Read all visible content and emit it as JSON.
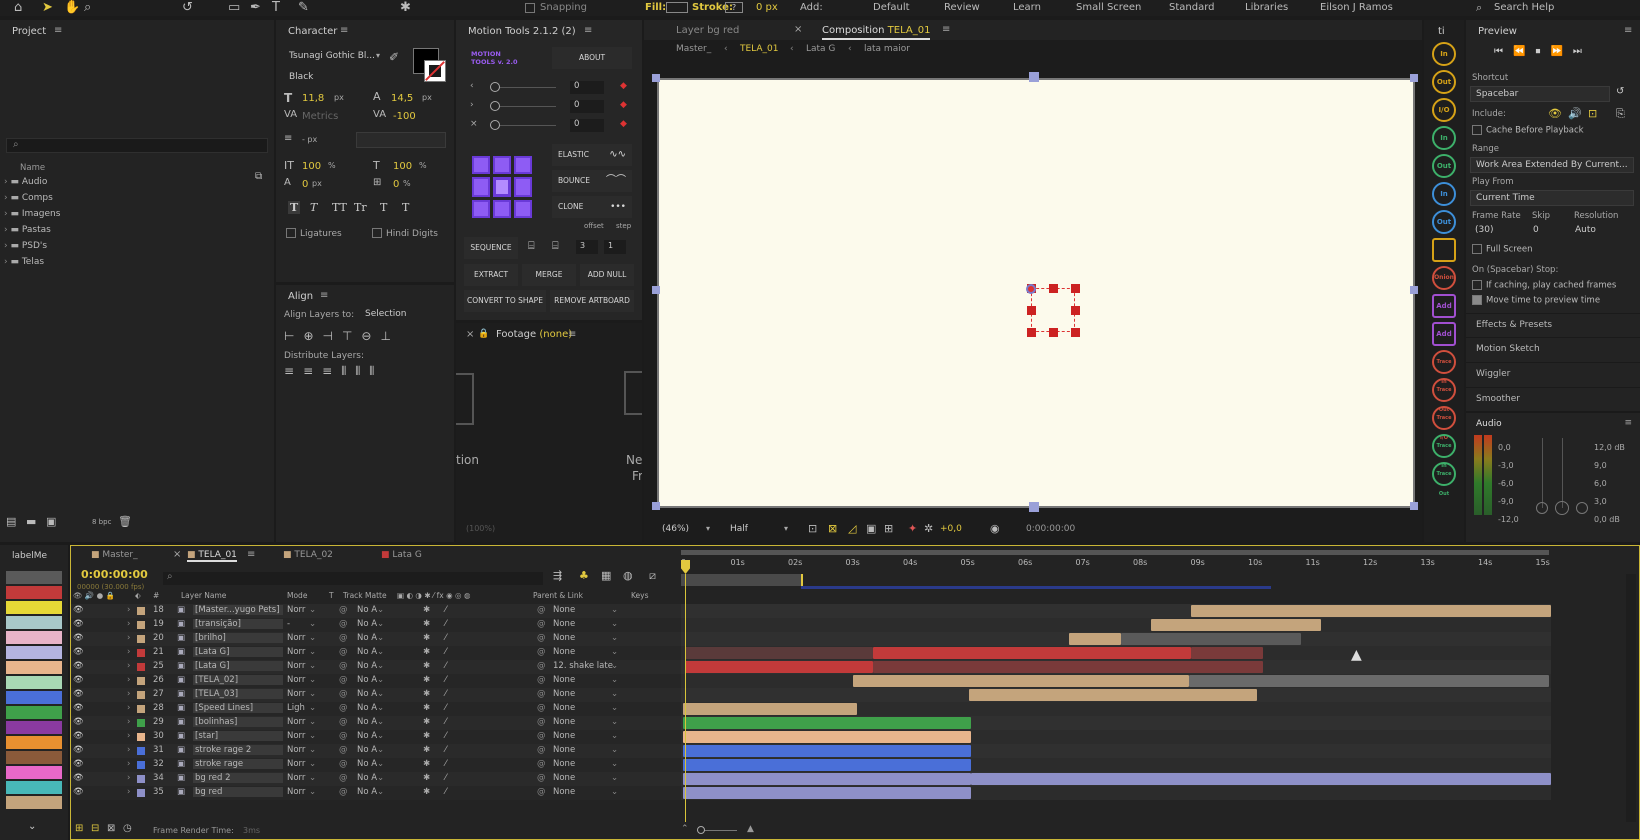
{
  "toolbar": {
    "fill_label": "Fill:",
    "stroke_label": "Stroke:",
    "stroke_value": "0 px",
    "add_label": "Add:",
    "snapping": "Snapping",
    "workspaces": [
      "Default",
      "Review",
      "Learn",
      "Small Screen",
      "Standard",
      "Libraries",
      "Eilson J Ramos"
    ],
    "search_help": "Search Help"
  },
  "project": {
    "title": "Project",
    "search_placeholder": "",
    "name_header": "Name",
    "folders": [
      "Audio",
      "Comps",
      "Imagens",
      "Pastas",
      "PSD's",
      "Telas"
    ],
    "bpc": "8 bpc"
  },
  "character": {
    "title": "Character",
    "font": "Tsunagi Gothic Bl...",
    "style": "Black",
    "size": "11,8",
    "size_unit": "px",
    "leading": "14,5",
    "leading_unit": "px",
    "kerning": "Metrics",
    "tracking": "-100",
    "stroke_unit": "- px",
    "vscale": "100",
    "vscale_unit": "%",
    "hscale": "100",
    "hscale_unit": "%",
    "baseline": "0",
    "baseline_unit": "px",
    "tsume": "0",
    "tsume_unit": "%",
    "ligatures": "Ligatures",
    "hindi": "Hindi Digits",
    "faux": [
      "T",
      "T",
      "TT",
      "Tr",
      "T",
      "T"
    ]
  },
  "align": {
    "title": "Align",
    "align_to_label": "Align Layers to:",
    "align_to_value": "Selection",
    "distribute_label": "Distribute Layers:"
  },
  "motion_tools": {
    "title": "Motion Tools 2.1.2 (2)",
    "logo": "MOTION TOOLS v. 2.0",
    "about": "ABOUT",
    "values": [
      "0",
      "0",
      "0"
    ],
    "elastic": "ELASTIC",
    "bounce": "BOUNCE",
    "clone": "CLONE",
    "offset": "offset",
    "step": "step",
    "sequence": "SEQUENCE",
    "seq_a": "3",
    "seq_b": "1",
    "extract": "EXTRACT",
    "merge": "MERGE",
    "add_null": "ADD NULL",
    "convert": "CONVERT TO SHAPE",
    "remove_artboard": "REMOVE ARTBOARD"
  },
  "footage": {
    "title": "Footage",
    "title_suffix": "(none)",
    "fragment_a": "tion",
    "fragment_b": "New",
    "fragment_c": "Fr"
  },
  "viewer": {
    "tab_layer": "Layer",
    "tab_layer_name": "bg red",
    "tab_comp": "Composition",
    "tab_comp_name": "TELA_01",
    "crumbs": [
      "Master_",
      "TELA_01",
      "Lata G",
      "lata maior"
    ],
    "zoom": "(46%)",
    "resolution": "Half",
    "exposure": "+0,0",
    "timecode": "0:00:00:00",
    "faded_zoom": "(100%)"
  },
  "right_sidebar": {
    "buttons": [
      "In",
      "Out",
      "I/O",
      "In",
      "Out",
      "In",
      "Out",
      "",
      "Onion",
      "Add",
      "Add",
      "Trace In",
      "Trace Out",
      "Trace I/O",
      "Trace In",
      "Trace Out"
    ]
  },
  "preview": {
    "title": "Preview",
    "shortcut_label": "Shortcut",
    "shortcut_value": "Spacebar",
    "include_label": "Include:",
    "cache_before": "Cache Before Playback",
    "range_label": "Range",
    "range_value": "Work Area Extended By Current...",
    "play_from_label": "Play From",
    "play_from_value": "Current Time",
    "frame_rate_label": "Frame Rate",
    "frame_rate_value": "(30)",
    "skip_label": "Skip",
    "skip_value": "0",
    "resolution_label": "Resolution",
    "resolution_value": "Auto",
    "full_screen": "Full Screen",
    "stop_label": "On (Spacebar) Stop:",
    "if_caching": "If caching, play cached frames",
    "move_time": "Move time to preview time",
    "sections": [
      "Effects & Presets",
      "Motion Sketch",
      "Wiggler",
      "Smoother"
    ],
    "audio_title": "Audio",
    "audio_left": [
      "0,0",
      "-3,0",
      "-6,0",
      "-9,0",
      "-12,0"
    ],
    "audio_right": [
      "12,0 dB",
      "9,0",
      "6,0",
      "3,0",
      "0,0 dB"
    ]
  },
  "timeline": {
    "label_panel": "labelMe",
    "tabs": [
      "Master_",
      "TELA_01",
      "TELA_02",
      "Lata G"
    ],
    "time": "0:00:00:00",
    "fps": "00000 (30.000 fps)",
    "columns": {
      "layer_name": "Layer Name",
      "mode": "Mode",
      "t": "T",
      "track_matte": "Track Matte",
      "parent": "Parent & Link",
      "keys": "Keys"
    },
    "ruler": [
      "0s",
      "01s",
      "02s",
      "03s",
      "04s",
      "05s",
      "06s",
      "07s",
      "08s",
      "09s",
      "10s",
      "11s",
      "12s",
      "13s",
      "14s",
      "15s"
    ],
    "footer": "Frame Render Time:",
    "footer_value": "3ms",
    "layers": [
      {
        "num": "18",
        "name": "[Master...yugo Pets]",
        "mode": "Norr",
        "matte": "No A",
        "parent": "None",
        "color": "#c4a47c"
      },
      {
        "num": "19",
        "name": "[transição]",
        "mode": "-",
        "matte": "No A",
        "parent": "None",
        "color": "#c4a47c"
      },
      {
        "num": "20",
        "name": "[brilho]",
        "mode": "Norr",
        "matte": "No A",
        "parent": "None",
        "color": "#c4a47c"
      },
      {
        "num": "21",
        "name": "[Lata G]",
        "mode": "Norr",
        "matte": "No A",
        "parent": "None",
        "color": "#c23a3a"
      },
      {
        "num": "25",
        "name": "[Lata G]",
        "mode": "Norr",
        "matte": "No A",
        "parent": "12. shake late",
        "color": "#c23a3a"
      },
      {
        "num": "26",
        "name": "[TELA_02]",
        "mode": "Norr",
        "matte": "No A",
        "parent": "None",
        "color": "#c4a47c"
      },
      {
        "num": "27",
        "name": "[TELA_03]",
        "mode": "Norr",
        "matte": "No A",
        "parent": "None",
        "color": "#c4a47c"
      },
      {
        "num": "28",
        "name": "[Speed Lines]",
        "mode": "Ligh",
        "matte": "No A",
        "parent": "None",
        "color": "#c4a47c"
      },
      {
        "num": "29",
        "name": "[bolinhas]",
        "mode": "Norr",
        "matte": "No A",
        "parent": "None",
        "color": "#3fa04a"
      },
      {
        "num": "30",
        "name": "[star]",
        "mode": "Norr",
        "matte": "No A",
        "parent": "None",
        "color": "#e8b58c"
      },
      {
        "num": "31",
        "name": "stroke rage 2",
        "mode": "Norr",
        "matte": "No A",
        "parent": "None",
        "color": "#4a6fd8"
      },
      {
        "num": "32",
        "name": "stroke rage",
        "mode": "Norr",
        "matte": "No A",
        "parent": "None",
        "color": "#4a6fd8"
      },
      {
        "num": "34",
        "name": "bg red 2",
        "mode": "Norr",
        "matte": "No A",
        "parent": "None",
        "color": "#8e90c8"
      },
      {
        "num": "35",
        "name": "bg red",
        "mode": "Norr",
        "matte": "No A",
        "parent": "None",
        "color": "#8e90c8"
      }
    ]
  }
}
